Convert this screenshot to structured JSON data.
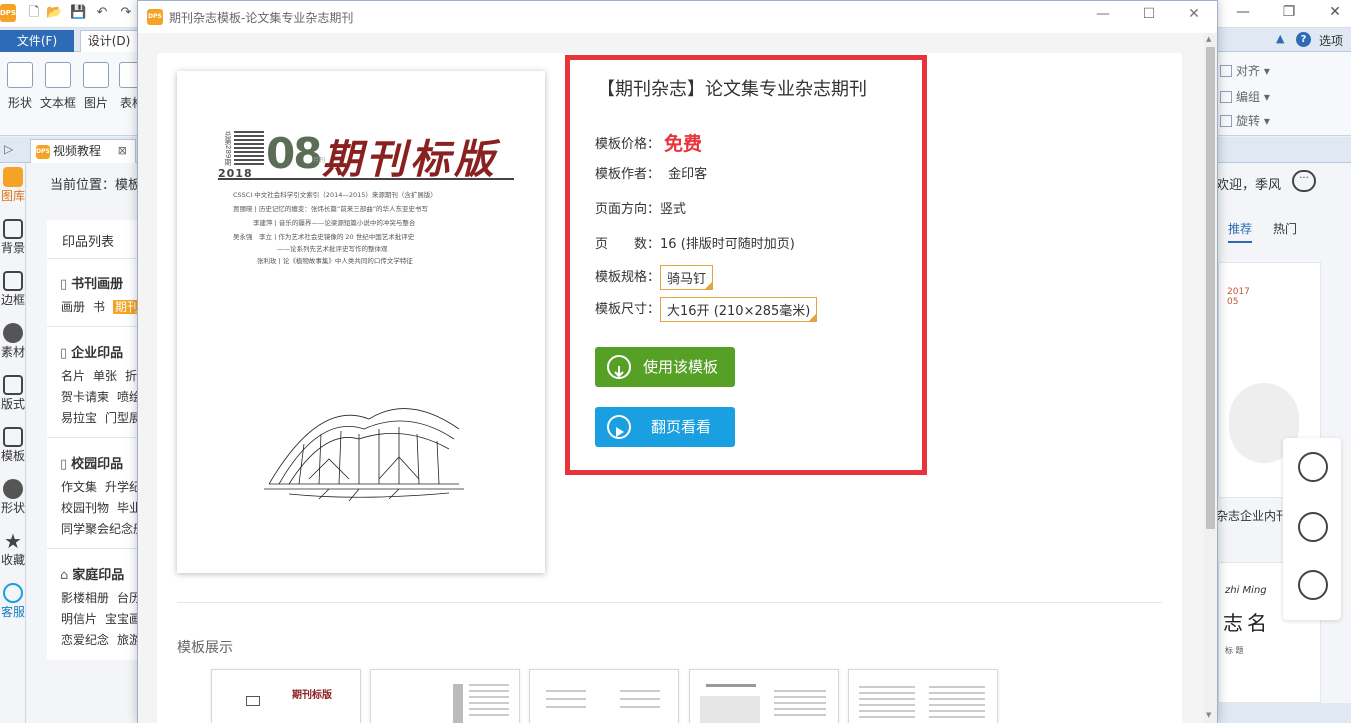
{
  "background_app": {
    "tabs": {
      "file": "文件(F)",
      "design": "设计(D)",
      "options": "选项"
    },
    "ribbon_buttons": [
      "形状",
      "文本框",
      "图片",
      "表格"
    ],
    "ribbon_right": [
      "对齐",
      "编组",
      "旋转"
    ],
    "doc_tab": "视频教程",
    "left_nav": [
      "图库",
      "背景",
      "边框",
      "素材",
      "版式",
      "模板",
      "形状",
      "收藏",
      "客服"
    ],
    "breadcrumb": "当前位置：模板",
    "list_title": "印品列表",
    "categories": [
      {
        "name": "书刊画册",
        "items": [
          "画册",
          "书",
          "期刊"
        ]
      },
      {
        "name": "企业印品",
        "items": [
          "名片",
          "单张",
          "折页"
        ],
        "items2": [
          "贺卡请柬",
          "喷绘"
        ],
        "items3": [
          "易拉宝",
          "门型展架"
        ]
      },
      {
        "name": "校园印品",
        "items": [
          "作文集",
          "升学纪念"
        ],
        "items2": [
          "校园刊物",
          "毕业"
        ],
        "items3": [
          "同学聚会纪念册"
        ]
      },
      {
        "name": "家庭印品",
        "items": [
          "影楼相册",
          "台历"
        ],
        "items2": [
          "明信片",
          "宝宝画册"
        ],
        "items3": [
          "恋爱纪念",
          "旅游"
        ]
      }
    ],
    "welcome": "欢迎，季风",
    "right_tabs": {
      "recommend": "推荐",
      "hot": "热门"
    },
    "right_caption": "杂志企业内刊",
    "right_thumb2_text": "zhi Ming",
    "right_thumb2_title": "志名",
    "right_thumb2_sub": "标 题"
  },
  "dialog": {
    "title": "期刊杂志模板-论文集专业杂志期刊",
    "cover": {
      "vol_label": "总第289期",
      "year": "2018",
      "issue": "08",
      "issue_tag": "月刊",
      "title": "期刊标版",
      "toc": [
        "CSSCI 中文社会科学引文索引（2014—2015）来源期刊（含扩展版）",
        "贾丽晓 | 历史记忆的嬗变：张炜长篇“前来三部曲”的华人东亚史书写",
        "李建萍 | 音乐的疆界——论梁源短篇小说中的冲突与整合",
        "吴永强　李立 | 作为艺术社会史镜像的 20 世纪中国艺术批评史",
        "——论系列先艺术批评史写作的整体观",
        "张利玫 | 论《植物故事集》中人类共同的口传文学特征"
      ]
    },
    "info": {
      "heading": "【期刊杂志】论文集专业杂志期刊",
      "price_label": "模板价格：",
      "price_value": "免费",
      "author_label": "模板作者：",
      "author_value": "金印客",
      "orientation_label": "页面方向：",
      "orientation_value": "竖式",
      "pages_label": "页　　数：",
      "pages_value": "16 (排版时可随时加页)",
      "spec_label": "模板规格：",
      "spec_value": "骑马钉",
      "size_label": "模板尺寸：",
      "size_value": "大16开 (210×285毫米)",
      "use_button": "使用该模板",
      "flip_button": "翻页看看"
    },
    "showcase_title": "模板展示",
    "showcase_thumb1_title": "期刊标版"
  },
  "colors": {
    "accent_red": "#e8333b",
    "use_green": "#57a026",
    "flip_blue": "#1aa0e0",
    "cover_title": "#8a2121",
    "tag_border": "#e2a343"
  }
}
